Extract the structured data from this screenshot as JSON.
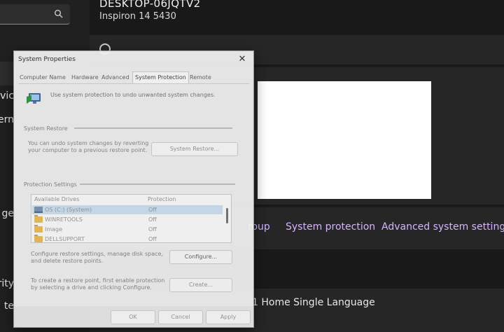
{
  "settings": {
    "device_name": "DESKTOP-06JQTV2",
    "device_model": "Inspiron 14 5430",
    "sidebar_fragments": [
      "evic",
      "tern",
      "ge",
      "rity",
      "te"
    ],
    "related_links": [
      "roup",
      "System protection",
      "Advanced system settings"
    ],
    "edition_text": "1 Home Single Language",
    "accent_color": "#d8b4ff"
  },
  "dialog": {
    "title": "System Properties",
    "close_label": "✕",
    "tabs": [
      "Computer Name",
      "Hardware",
      "Advanced",
      "System Protection",
      "Remote"
    ],
    "active_tab": "System Protection",
    "intro": "Use system protection to undo unwanted system changes.",
    "system_restore": {
      "label": "System Restore",
      "text": "You can undo system changes by reverting\nyour computer to a previous restore point.",
      "button": "System Restore..."
    },
    "protection_settings": {
      "label": "Protection Settings",
      "columns": [
        "Available Drives",
        "Protection"
      ],
      "drives": [
        {
          "name": "OS (C:) (System)",
          "protection": "Off",
          "icon": "hard-drive-icon",
          "selected": true
        },
        {
          "name": "WINRETOOLS",
          "protection": "Off",
          "icon": "folder-icon",
          "selected": false
        },
        {
          "name": "Image",
          "protection": "Off",
          "icon": "folder-icon",
          "selected": false
        },
        {
          "name": "DELLSUPPORT",
          "protection": "Off",
          "icon": "folder-icon",
          "selected": false
        }
      ]
    },
    "configure": {
      "text": "Configure restore settings, manage disk space,\nand delete restore points.",
      "button": "Configure..."
    },
    "create": {
      "text": "To create a restore point, first enable protection\nby selecting a drive and clicking Configure.",
      "button": "Create..."
    },
    "footer": {
      "ok": "OK",
      "cancel": "Cancel",
      "apply": "Apply"
    }
  }
}
